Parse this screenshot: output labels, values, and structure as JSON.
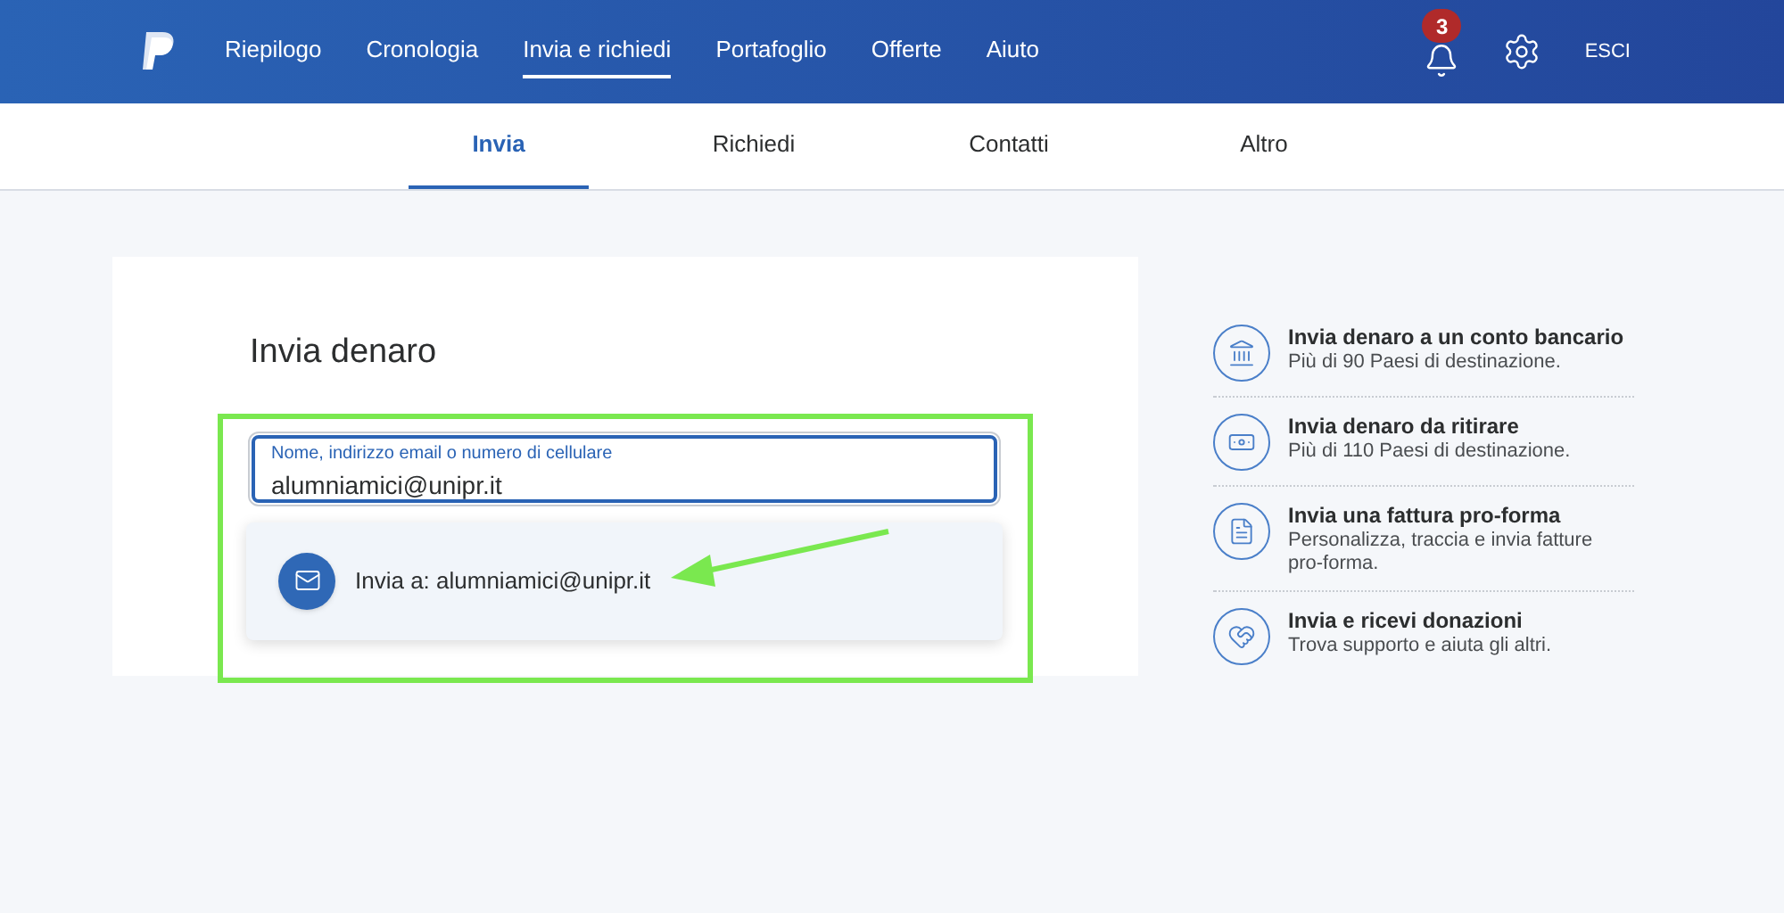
{
  "top_nav": {
    "items": [
      {
        "label": "Riepilogo",
        "selected": false
      },
      {
        "label": "Cronologia",
        "selected": false
      },
      {
        "label": "Invia e richiedi",
        "selected": true
      },
      {
        "label": "Portafoglio",
        "selected": false
      },
      {
        "label": "Offerte",
        "selected": false
      },
      {
        "label": "Aiuto",
        "selected": false
      }
    ],
    "notifications_count": "3",
    "logout": "ESCI"
  },
  "sub_tabs": [
    {
      "label": "Invia",
      "selected": true
    },
    {
      "label": "Richiedi",
      "selected": false
    },
    {
      "label": "Contatti",
      "selected": false
    },
    {
      "label": "Altro",
      "selected": false
    }
  ],
  "send_card": {
    "title": "Invia denaro",
    "field": {
      "label": "Nome, indirizzo email o numero di cellulare",
      "value": "alumniamici@unipr.it"
    },
    "suggestion": "Invia a: alumniamici@unipr.it"
  },
  "options": [
    {
      "kind": "bank",
      "title": "Invia denaro a un conto bancario",
      "subtitle": "Più di 90 Paesi di destinazione."
    },
    {
      "kind": "cash",
      "title": "Invia denaro da ritirare",
      "subtitle": "Più di 110 Paesi di destinazione."
    },
    {
      "kind": "invoice",
      "title": "Invia una fattura pro-forma",
      "subtitle": "Personalizza, traccia e invia fatture pro-forma."
    },
    {
      "kind": "donation",
      "title": "Invia e ricevi donazioni",
      "subtitle": "Trova supporto e aiuta gli altri."
    }
  ]
}
